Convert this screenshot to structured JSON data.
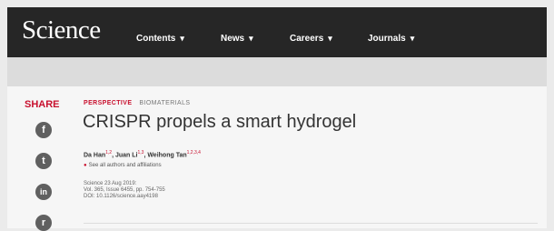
{
  "header": {
    "logo": "Science",
    "nav": [
      {
        "label": "Contents",
        "chevron": "▾"
      },
      {
        "label": "News",
        "chevron": "▾"
      },
      {
        "label": "Careers",
        "chevron": "▾"
      },
      {
        "label": "Journals",
        "chevron": "▾"
      }
    ]
  },
  "share": {
    "label": "SHARE",
    "icons": [
      {
        "name": "facebook-icon",
        "glyph": "f"
      },
      {
        "name": "twitter-icon",
        "glyph": "t"
      },
      {
        "name": "linkedin-icon",
        "glyph": "in"
      },
      {
        "name": "reddit-icon",
        "glyph": "r"
      }
    ]
  },
  "article": {
    "type": "PERSPECTIVE",
    "subject": "BIOMATERIALS",
    "title": "CRISPR propels a smart hydrogel",
    "authors": [
      {
        "name": "Da Han",
        "sup": "1,2"
      },
      {
        "name": "Juan Li",
        "sup": "1,3"
      },
      {
        "name": "Weihong Tan",
        "sup": "1,2,3,4"
      }
    ],
    "see_all": "See all authors and affiliations",
    "meta": [
      "Science  23 Aug 2019:",
      "Vol. 365, Issue 6455, pp. 754-755",
      "DOI: 10.1126/science.aay4198"
    ]
  },
  "colors": {
    "accent": "#c8102e",
    "navbar": "#262626"
  }
}
